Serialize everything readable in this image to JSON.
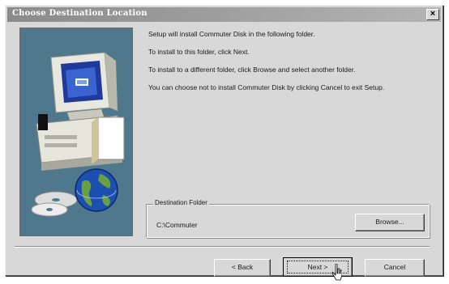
{
  "window": {
    "title": "Choose Destination Location",
    "close_label": "×"
  },
  "messages": [
    "Setup will install Commuter Disk in the following folder.",
    "To install to this folder, click Next.",
    "To install to a different folder, click Browse and select another folder.",
    "You can choose not to install Commuter Disk by clicking Cancel to exit Setup."
  ],
  "destination": {
    "legend": "Destination Folder",
    "path": "C:\\Commuter",
    "browse_label": "Browse..."
  },
  "buttons": {
    "back_label": "< Back",
    "next_label": "Next >",
    "cancel_label": "Cancel"
  },
  "icons": {
    "close": "close-icon",
    "art": "setup-computer-illustration",
    "cursor": "mouse-pointer-icon"
  },
  "colors": {
    "dialog_bg": "#d8d8d8",
    "titlebar": "#8a8a8a",
    "art_bg": "#50788c"
  }
}
